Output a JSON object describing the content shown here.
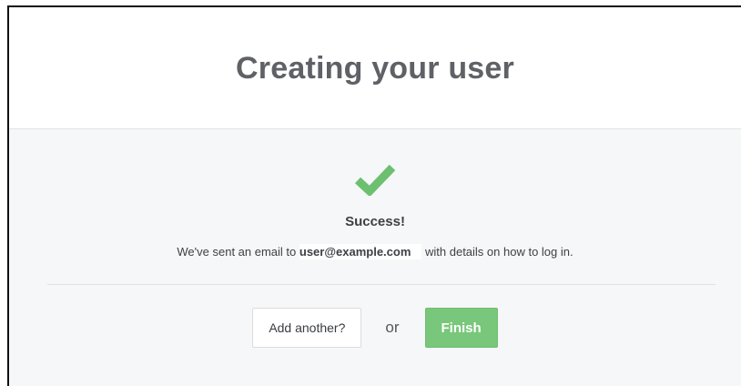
{
  "dialog": {
    "title": "Creating your user"
  },
  "result": {
    "icon": "checkmark-icon",
    "status": "Success!",
    "message_prefix": "We've sent an email to ",
    "email": "user@example.com",
    "message_suffix": " with details on how to log in."
  },
  "actions": {
    "add_another_label": "Add another?",
    "or_label": "or",
    "finish_label": "Finish"
  },
  "colors": {
    "success_green": "#6cc070",
    "finish_button": "#78c77a",
    "title_text": "#5f6166"
  }
}
